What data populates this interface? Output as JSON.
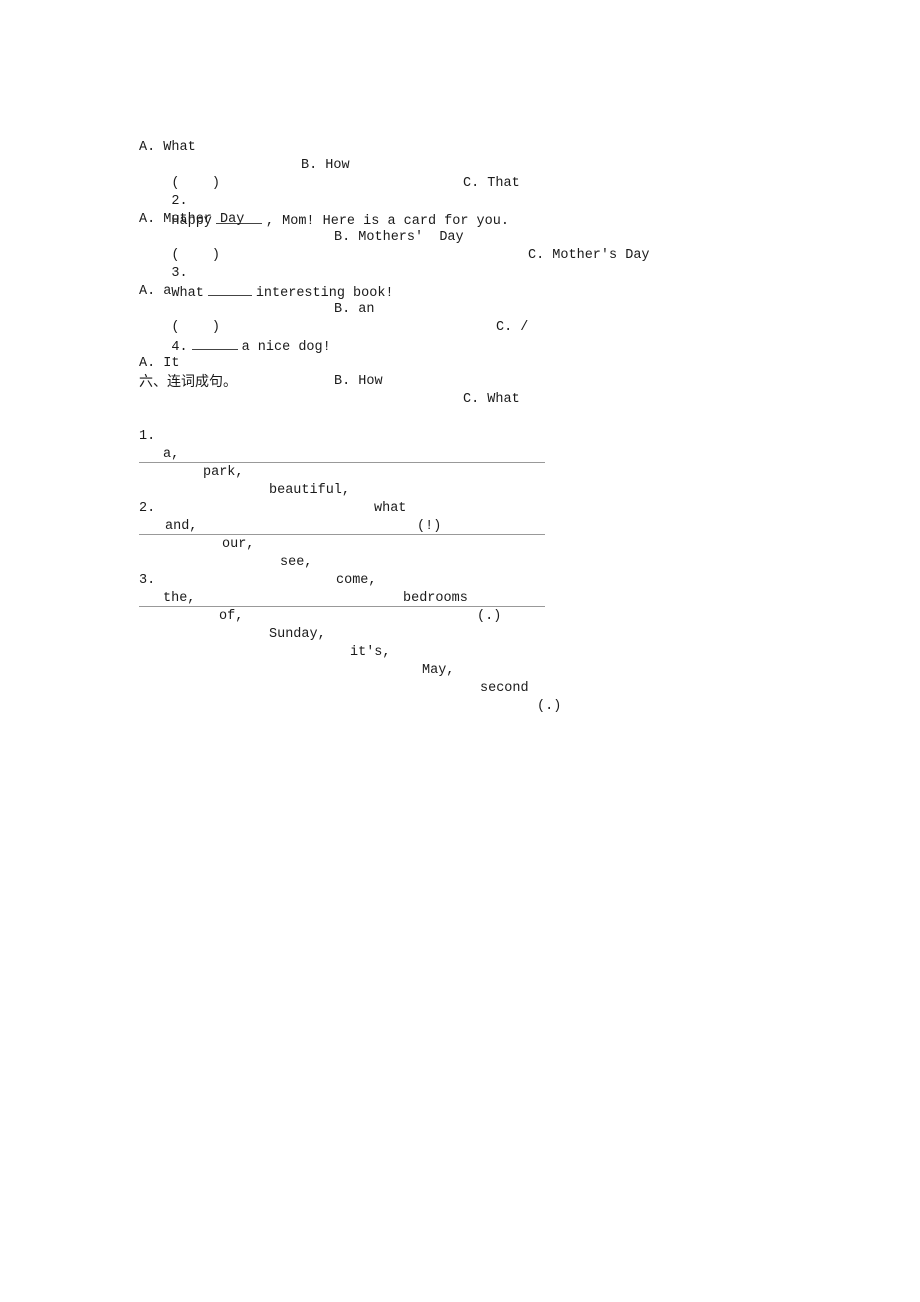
{
  "document": {
    "q1_options": {
      "a": "A. What",
      "b": "B. How",
      "c": "C. That"
    },
    "questions": [
      {
        "paren": "(    )",
        "number": "2.",
        "before": "Happy",
        "after": ", Mom! Here is a card for you.",
        "options": {
          "a": "A. Mother Day",
          "b": "B. Mothers'  Day",
          "c": "C. Mother's Day"
        }
      },
      {
        "paren": "(    )",
        "number": "3.",
        "before": "What",
        "after": "interesting book!",
        "options": {
          "a": "A. a",
          "b": "B. an",
          "c": "C. /"
        }
      },
      {
        "paren": "(    )",
        "number": "4.",
        "before": "",
        "after": "a nice dog!",
        "options": {
          "a": "A. It",
          "b": "B. How",
          "c": "C. What"
        }
      }
    ],
    "section_heading": "六、连词成句。",
    "sentence_tasks": [
      {
        "number": "1.",
        "words": [
          "a,",
          "park,",
          "beautiful,",
          "what"
        ],
        "punct": "(!)"
      },
      {
        "number": "2.",
        "words": [
          "and,",
          "our,",
          "see,",
          "come,",
          "bedrooms"
        ],
        "punct": "(.)"
      },
      {
        "number": "3.",
        "words": [
          "the,",
          "of,",
          "Sunday,",
          "it's,",
          "May,",
          "second"
        ],
        "punct": "(.)"
      }
    ]
  }
}
